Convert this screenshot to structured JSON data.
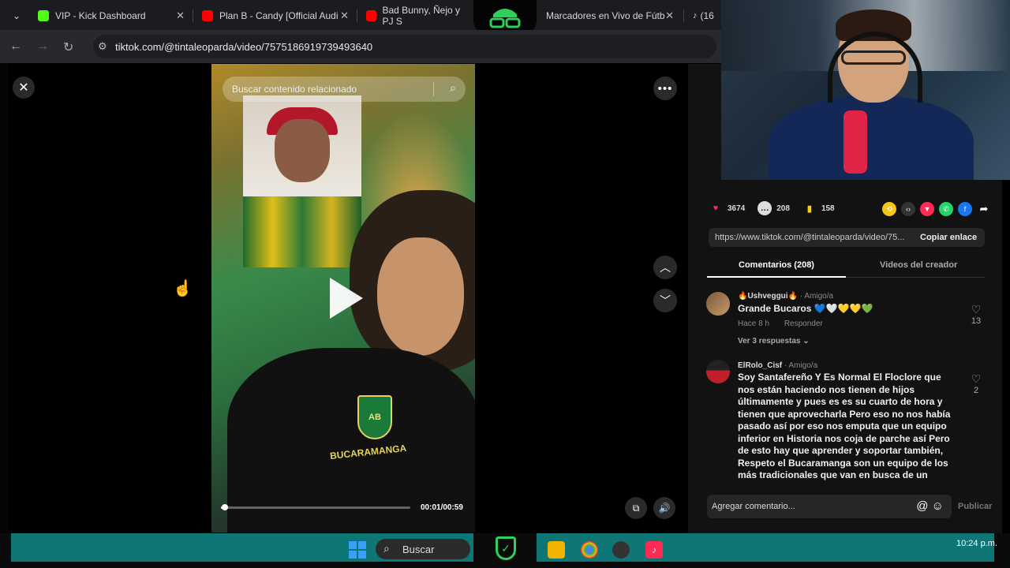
{
  "browser": {
    "tabs": [
      {
        "title": "VIP - Kick Dashboard",
        "icon": "kick-icon",
        "color": "#53fc18"
      },
      {
        "title": "Plan B - Candy [Official Audi",
        "icon": "youtube-icon",
        "color": "#ff0000"
      },
      {
        "title": "Bad Bunny, Ñejo y PJ S",
        "icon": "youtube-icon",
        "color": "#ff0000"
      },
      {
        "title": "Marcadores en Vivo de Fútb",
        "icon": "globe-icon",
        "color": "#888888"
      },
      {
        "title": "(16",
        "icon": "tiktok-icon",
        "color": "#ffffff"
      }
    ],
    "url": "tiktok.com/@tintaleoparda/video/7575186919739493640"
  },
  "video": {
    "search_placeholder": "Buscar contenido relacionado",
    "time": "00:01/00:59",
    "progress": 0.02,
    "crest_text": "AB",
    "shirt_text": "BUCARAMANGA"
  },
  "panel": {
    "likes": "3674",
    "comments_count": "208",
    "saves": "158",
    "link": "https://www.tiktok.com/@tintaleoparda/video/75...",
    "copy_link": "Copiar enlace",
    "tab_comments": "Comentarios (208)",
    "tab_videos": "Videos del creador",
    "comments": [
      {
        "user": "🔥Ushveggui🔥",
        "relation": "· Amigo/a",
        "text": "Grande Bucaros 💙🤍💛💛💚",
        "time": "Hace 8 h",
        "reply": "Responder",
        "replies": "Ver 3 respuestas ⌄",
        "likes": "13"
      },
      {
        "user": "ElRolo_Cisf",
        "relation": "· Amigo/a",
        "text": "Soy Santafereño Y Es Normal El Floclore que nos están haciendo nos tienen de hijos últimamente y pues es es su cuarto de hora y tienen que aprovecharla Pero eso no nos había pasado así por eso nos emputa que un equipo inferior en Historia nos coja de parche así Pero de esto hay que aprender y soportar también, Respeto el Bucaramanga son un equipo de los más tradicionales que van en busca de un crecimiento.",
        "likes": "2"
      }
    ],
    "composer_placeholder": "Agregar comentario...",
    "publish": "Publicar"
  },
  "taskbar": {
    "search_label": "Buscar",
    "time": "10:24 p.m."
  }
}
